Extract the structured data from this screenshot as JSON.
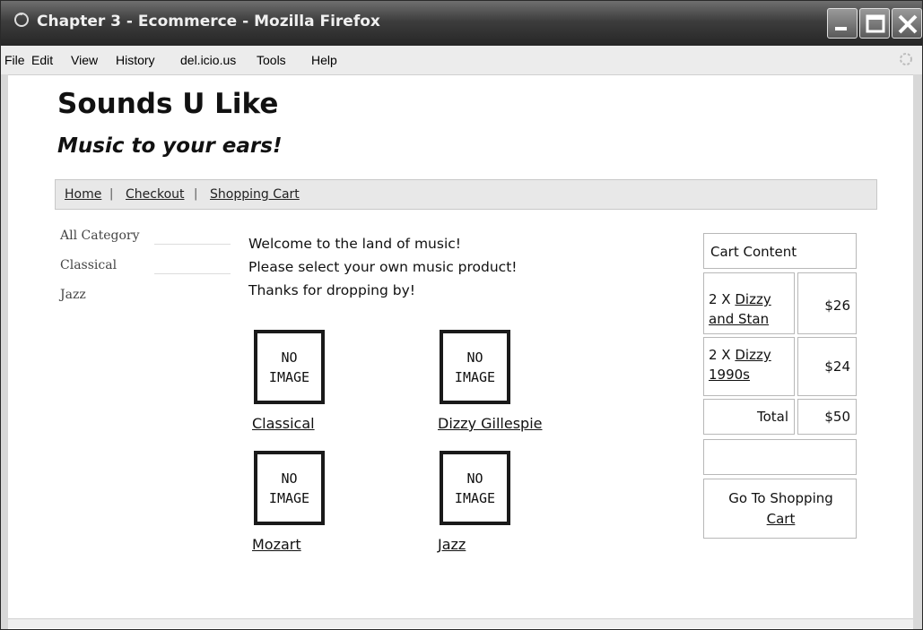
{
  "window": {
    "title": "Chapter 3 - Ecommerce - Mozilla Firefox"
  },
  "menu": {
    "items": [
      "File",
      "Edit",
      "View",
      "History",
      "del.icio.us",
      "Tools",
      "Help"
    ]
  },
  "site": {
    "title": "Sounds U Like",
    "tagline": "Music to your ears!"
  },
  "nav": {
    "links": [
      "Home",
      "Checkout",
      "Shopping Cart"
    ],
    "separator": "|"
  },
  "categories": [
    "All Category",
    "Classical",
    "Jazz"
  ],
  "welcome": {
    "lines": [
      "Welcome to the land of music!",
      "Please select your own music product!",
      "Thanks for dropping by!"
    ]
  },
  "products": [
    {
      "image_text_1": "NO",
      "image_text_2": "IMAGE",
      "name": "Classical"
    },
    {
      "image_text_1": "NO",
      "image_text_2": "IMAGE",
      "name": "Dizzy Gillespie"
    },
    {
      "image_text_1": "NO",
      "image_text_2": "IMAGE",
      "name": "Mozart"
    },
    {
      "image_text_1": "NO",
      "image_text_2": "IMAGE",
      "name": "Jazz"
    }
  ],
  "cart": {
    "header": "Cart Content",
    "items": [
      {
        "qty": "2 X",
        "name_line1": "Dizzy",
        "name_line2": "and Stan",
        "price": "$26"
      },
      {
        "qty": "2 X",
        "name_line1": "Dizzy",
        "name_line2": "1990s",
        "price": "$24"
      }
    ],
    "total_label": "Total",
    "total_value": "$50",
    "goto_line1": "Go To Shopping",
    "goto_line2": "Cart"
  },
  "icons": {
    "app": "firefox-icon",
    "minimize": "minimize-icon",
    "maximize": "maximize-icon",
    "close": "close-icon",
    "throbber": "throbber-icon"
  }
}
